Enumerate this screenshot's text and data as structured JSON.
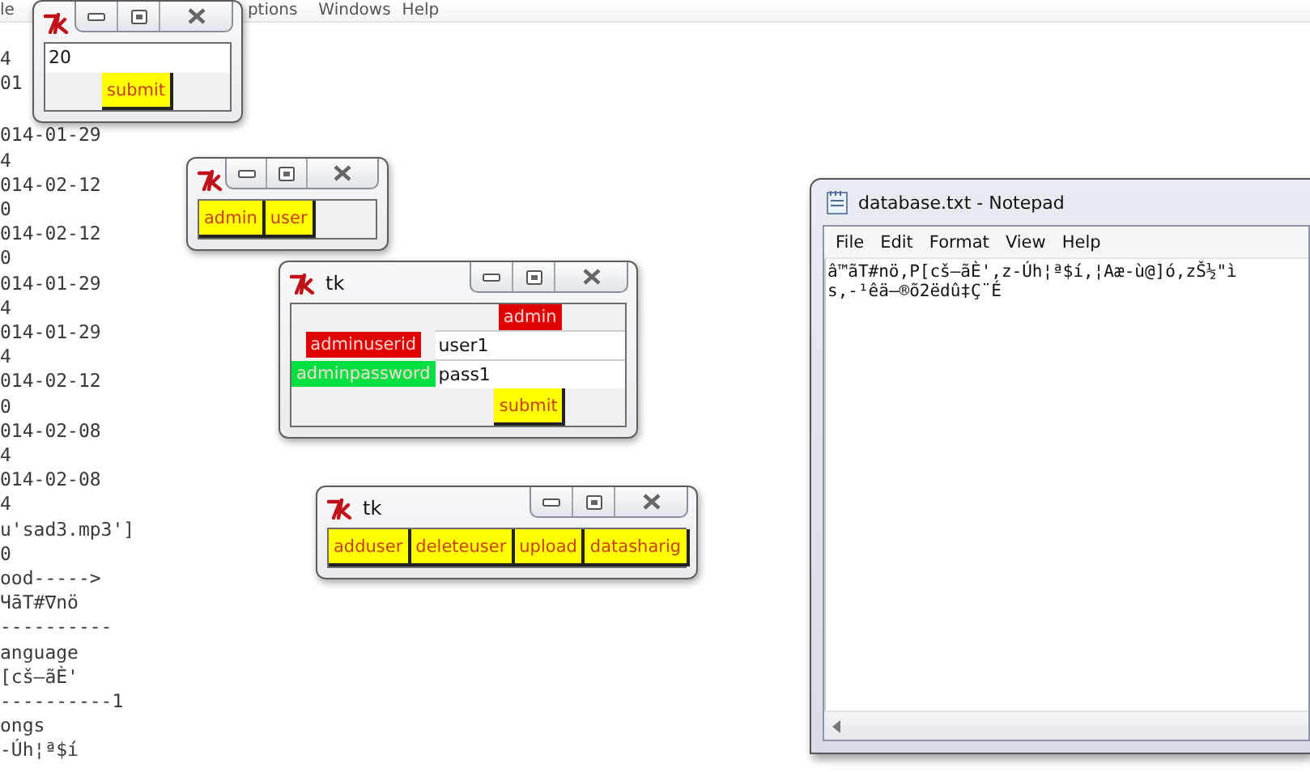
{
  "editor": {
    "menu": [
      "le",
      "ptions",
      "Windows",
      "Help"
    ],
    "text_block_1": [
      "4",
      "01"
    ],
    "text_block_2": [
      "014-01-29",
      "4",
      "014-02-12",
      "0",
      "014-02-12",
      "0",
      "014-01-29",
      "4",
      "014-01-29",
      "4",
      "014-02-12",
      "0",
      "014-02-08",
      "4",
      "014-02-08",
      "4",
      "u'sad3.mp3']",
      "0",
      "ood----->",
      "ЧāT#∇nö",
      "----------",
      "anguage",
      "[cš–ãÈ'",
      "----------1",
      "ongs",
      "-Úh¦ª$í"
    ]
  },
  "tk_windows": [
    {
      "body": [
        {
          "kind": "entry",
          "value": "20"
        },
        {
          "kind": "button",
          "label": "submit"
        }
      ]
    },
    {
      "body": [
        {
          "kind": "button_row",
          "buttons": [
            "admin",
            "user"
          ]
        }
      ]
    },
    {
      "title": "tk",
      "body": [
        {
          "kind": "label",
          "text": "admin",
          "color": "#e00000"
        },
        {
          "kind": "field_row",
          "label": {
            "text": "adminuserid",
            "color": "#e00000"
          },
          "value": "user1"
        },
        {
          "kind": "field_row",
          "label": {
            "text": "adminpassword",
            "color": "#00e040"
          },
          "value": "pass1"
        },
        {
          "kind": "button",
          "label": "submit"
        }
      ]
    },
    {
      "title": "tk",
      "body": [
        {
          "kind": "button_row",
          "buttons": [
            "adduser",
            "deleteuser",
            "upload",
            "datasharig"
          ]
        }
      ]
    }
  ],
  "notepad": {
    "title": "database.txt - Notepad",
    "menu": [
      "File",
      "Edit",
      "Format",
      "View",
      "Help"
    ],
    "lines": [
      "â™ãT#nö,P[cš–ãÈ',z-Úh¦ª$í,¦Aæ-ù@]ó,zŠ½\"ì",
      "s,-¹êä–®õ2ëdû‡Ç¨É"
    ]
  }
}
